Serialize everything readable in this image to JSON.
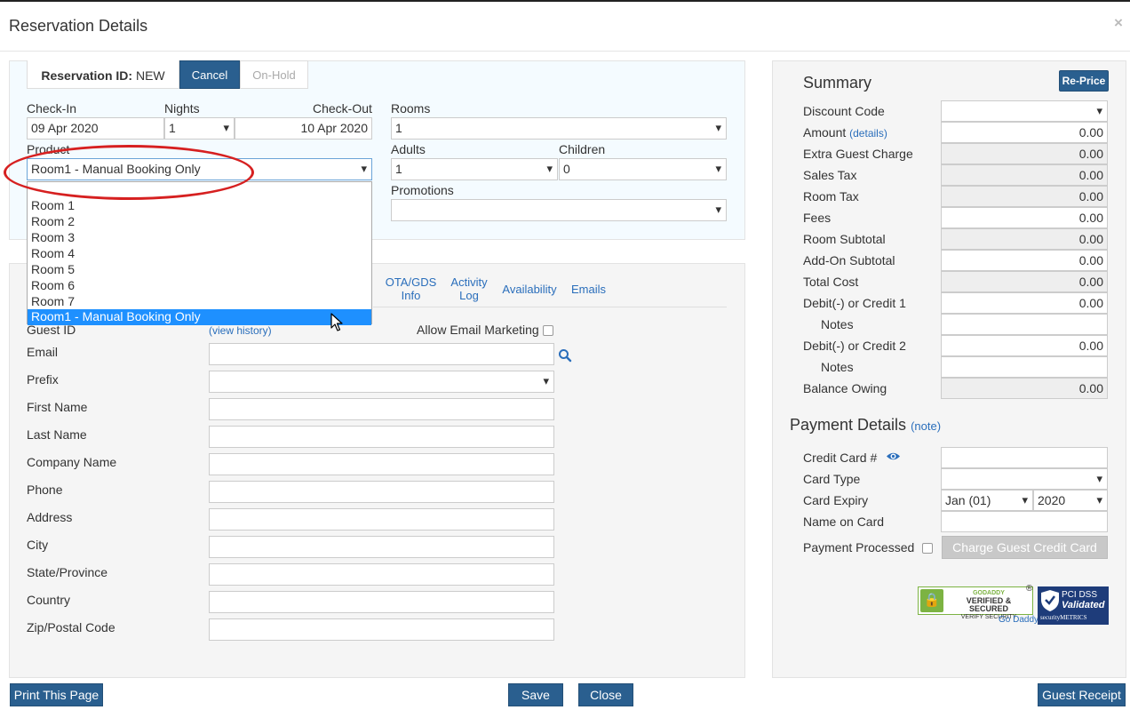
{
  "modal": {
    "title": "Reservation Details",
    "close_glyph": "×"
  },
  "res_tabs": {
    "id_label": "Reservation ID:",
    "id_value": "NEW",
    "cancel": "Cancel",
    "onhold": "On-Hold"
  },
  "booking": {
    "checkin_label": "Check-In",
    "checkin_value": "09 Apr 2020",
    "nights_label": "Nights",
    "nights_value": "1",
    "checkout_label": "Check-Out",
    "checkout_value": "10 Apr 2020",
    "rooms_label": "Rooms",
    "rooms_value": "1",
    "product_label": "Product",
    "product_value": "Room1 - Manual Booking Only",
    "adults_label": "Adults",
    "adults_value": "1",
    "children_label": "Children",
    "children_value": "0",
    "promotions_label": "Promotions",
    "promotions_value": "",
    "product_options": [
      "Room 1",
      "Room 2",
      "Room 3",
      "Room 4",
      "Room 5",
      "Room 6",
      "Room 7",
      "Room1 - Manual Booking Only"
    ]
  },
  "guest_tabs": {
    "ota_line1": "OTA/GDS",
    "ota_line2": "Info",
    "activity_line1": "Activity",
    "activity_line2": "Log",
    "availability": "Availability",
    "emails": "Emails"
  },
  "guest": {
    "guest_id_label": "Guest ID",
    "view_history": "(view history)",
    "allow_marketing": "Allow Email Marketing",
    "email_label": "Email",
    "prefix_label": "Prefix",
    "first_name_label": "First Name",
    "last_name_label": "Last Name",
    "company_label": "Company Name",
    "phone_label": "Phone",
    "address_label": "Address",
    "city_label": "City",
    "state_label": "State/Province",
    "country_label": "Country",
    "zip_label": "Zip/Postal Code"
  },
  "summary": {
    "title": "Summary",
    "reprice": "Re-Price",
    "discount_code": "Discount Code",
    "amount": "Amount",
    "amount_details": "(details)",
    "amount_value": "0.00",
    "extra_guest": "Extra Guest Charge",
    "extra_guest_value": "0.00",
    "sales_tax": "Sales Tax",
    "sales_tax_value": "0.00",
    "room_tax": "Room Tax",
    "room_tax_value": "0.00",
    "fees": "Fees",
    "fees_value": "0.00",
    "room_subtotal": "Room Subtotal",
    "room_subtotal_value": "0.00",
    "addon_subtotal": "Add-On Subtotal",
    "addon_subtotal_value": "0.00",
    "total_cost": "Total Cost",
    "total_cost_value": "0.00",
    "debit1": "Debit(-) or Credit 1",
    "debit1_value": "0.00",
    "notes1": "Notes",
    "debit2": "Debit(-) or Credit 2",
    "debit2_value": "0.00",
    "notes2": "Notes",
    "balance": "Balance Owing",
    "balance_value": "0.00"
  },
  "payment": {
    "title": "Payment Details",
    "note": "(note)",
    "cc_number": "Credit Card #",
    "card_type": "Card Type",
    "card_expiry": "Card Expiry",
    "expiry_month": "Jan (01)",
    "expiry_year": "2020",
    "name_on_card": "Name on Card",
    "payment_processed": "Payment Processed",
    "charge_button": "Charge Guest Credit Card"
  },
  "badges": {
    "godaddy_line1": "GODADDY",
    "godaddy_line2": "VERIFIED & SECURED",
    "godaddy_line3": "VERIFY SECURITY",
    "godaddy_link": "Go Daddy",
    "registered": "®",
    "pci_line1": "PCI DSS",
    "pci_line2": "Validated",
    "pci_line3": "securityMETRICS"
  },
  "footer": {
    "print": "Print This Page",
    "save": "Save",
    "close": "Close",
    "receipt": "Guest Receipt"
  },
  "colors": {
    "primary_button": "#2a5f8f",
    "link": "#2a6ebb",
    "highlight": "#1e90ff",
    "annotation": "#d62020"
  }
}
